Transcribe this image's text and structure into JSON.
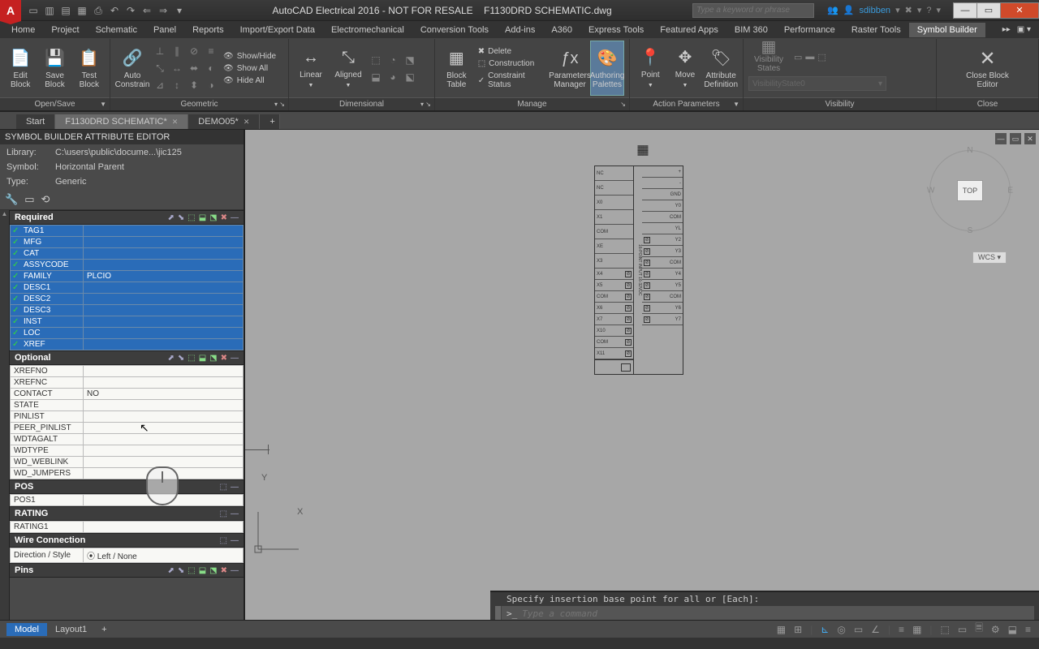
{
  "title": {
    "app": "AutoCAD Electrical 2016 - NOT FOR RESALE",
    "file": "F1130DRD SCHEMATIC.dwg"
  },
  "search": {
    "placeholder": "Type a keyword or phrase"
  },
  "user": {
    "name": "sdibben"
  },
  "menu": [
    "Home",
    "Project",
    "Schematic",
    "Panel",
    "Reports",
    "Import/Export Data",
    "Electromechanical",
    "Conversion Tools",
    "Add-ins",
    "A360",
    "Express Tools",
    "Featured Apps",
    "BIM 360",
    "Performance",
    "Raster Tools",
    "Symbol Builder"
  ],
  "menu_active": 15,
  "ribbon": {
    "open_save": {
      "title": "Open/Save",
      "edit": "Edit\nBlock",
      "save": "Save\nBlock",
      "test": "Test\nBlock"
    },
    "geometric": {
      "title": "Geometric",
      "auto": "Auto\nConstrain",
      "show_hide": "Show/Hide",
      "show_all": "Show All",
      "hide_all": "Hide All"
    },
    "dimensional": {
      "title": "Dimensional",
      "linear": "Linear",
      "aligned": "Aligned"
    },
    "manage": {
      "title": "Manage",
      "block_table": "Block\nTable",
      "delete": "Delete",
      "construction": "Construction",
      "constraint": "Constraint Status",
      "param": "Parameters\nManager",
      "auth": "Authoring\nPalettes"
    },
    "action": {
      "title": "Action Parameters",
      "point": "Point",
      "move": "Move",
      "attr": "Attribute\nDefinition"
    },
    "visibility": {
      "title": "Visibility",
      "states": "Visibility\nStates",
      "combo": "VisibilityState0"
    },
    "close": {
      "title": "Close",
      "btn": "Close\nBlock Editor"
    }
  },
  "doc_tabs": [
    {
      "label": "Start",
      "active": false,
      "closable": false
    },
    {
      "label": "F1130DRD SCHEMATIC*",
      "active": true,
      "closable": true
    },
    {
      "label": "DEMO05*",
      "active": false,
      "closable": true
    }
  ],
  "side": {
    "title": "SYMBOL BUILDER ATTRIBUTE EDITOR",
    "library_lbl": "Library:",
    "library": "C:\\users\\public\\docume...\\jic125",
    "symbol_lbl": "Symbol:",
    "symbol": "Horizontal Parent",
    "type_lbl": "Type:",
    "type": "Generic"
  },
  "groups": {
    "required": {
      "title": "Required",
      "rows": [
        {
          "k": "TAG1",
          "v": ""
        },
        {
          "k": "MFG",
          "v": ""
        },
        {
          "k": "CAT",
          "v": ""
        },
        {
          "k": "ASSYCODE",
          "v": ""
        },
        {
          "k": "FAMILY",
          "v": "PLCIO"
        },
        {
          "k": "DESC1",
          "v": ""
        },
        {
          "k": "DESC2",
          "v": ""
        },
        {
          "k": "DESC3",
          "v": ""
        },
        {
          "k": "INST",
          "v": ""
        },
        {
          "k": "LOC",
          "v": ""
        },
        {
          "k": "XREF",
          "v": ""
        }
      ]
    },
    "optional": {
      "title": "Optional",
      "rows": [
        {
          "k": "XREFNO",
          "v": ""
        },
        {
          "k": "XREFNC",
          "v": ""
        },
        {
          "k": "CONTACT",
          "v": "NO"
        },
        {
          "k": "STATE",
          "v": ""
        },
        {
          "k": "PINLIST",
          "v": ""
        },
        {
          "k": "PEER_PINLIST",
          "v": ""
        },
        {
          "k": "WDTAGALT",
          "v": ""
        },
        {
          "k": "WDTYPE",
          "v": ""
        },
        {
          "k": "WD_WEBLINK",
          "v": ""
        },
        {
          "k": "WD_JUMPERS",
          "v": ""
        }
      ]
    },
    "pos": {
      "title": "POS",
      "rows": [
        {
          "k": "POS1",
          "v": ""
        }
      ]
    },
    "rating": {
      "title": "RATING",
      "rows": [
        {
          "k": "RATING1",
          "v": ""
        }
      ]
    },
    "wire": {
      "title": "Wire Connection",
      "rows": [
        {
          "k": "Direction / Style",
          "v": "Left / None"
        }
      ]
    },
    "pins": {
      "title": "Pins"
    }
  },
  "viewcube": {
    "top": "TOP",
    "n": "N",
    "s": "S",
    "e": "E",
    "w": "W",
    "wcs": "WCS"
  },
  "ucs": {
    "x": "X",
    "y": "Y"
  },
  "cmd": {
    "hist": "Specify insertion base point for all or [Each]:",
    "placeholder": "Type a command",
    "prompt": ">_"
  },
  "bottom": {
    "model": "Model",
    "layout": "Layout1"
  },
  "drawing": {
    "left": [
      "NC",
      "NC",
      "X0",
      "X1",
      "COM",
      "XE",
      "X3",
      "X4",
      "X5",
      "COM",
      "X6",
      "X7",
      "X10",
      "COM",
      "X11"
    ],
    "right": [
      "+",
      "-",
      "GND",
      "Y0",
      "COM",
      "YL",
      "Y2",
      "Y3",
      "COM",
      "Y4",
      "Y5",
      "COM",
      "Y6",
      "Y7"
    ]
  }
}
